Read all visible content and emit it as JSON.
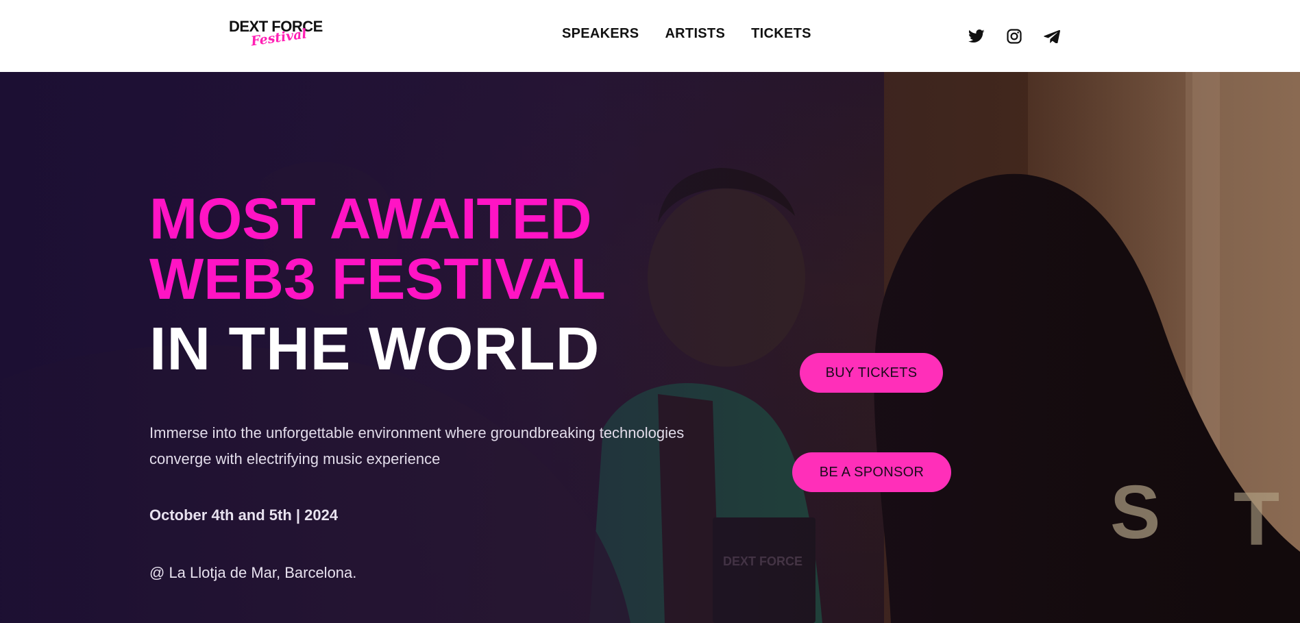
{
  "brand": {
    "logo_top": "DEXT FORCE",
    "logo_script": "Festival",
    "accent_color": "#ff14c4"
  },
  "nav": {
    "items": [
      {
        "label": "SPEAKERS"
      },
      {
        "label": "ARTISTS"
      },
      {
        "label": "TICKETS"
      }
    ]
  },
  "social": {
    "icons": [
      "twitter-icon",
      "instagram-icon",
      "telegram-icon"
    ]
  },
  "hero": {
    "headline_line1": "MOST AWAITED",
    "headline_line2": "WEB3 FESTIVAL",
    "headline_line3": "IN THE WORLD",
    "description": "Immerse into the unforgettable environment where groundbreaking technologies converge with electrifying music experience",
    "date": "October 4th and 5th | 2024",
    "venue": "@ La Llotja de Mar, Barcelona.",
    "buy_tickets_label": "BUY TICKETS",
    "sponsor_label": "BE A SPONSOR",
    "button_color": "#ff2fb9"
  }
}
